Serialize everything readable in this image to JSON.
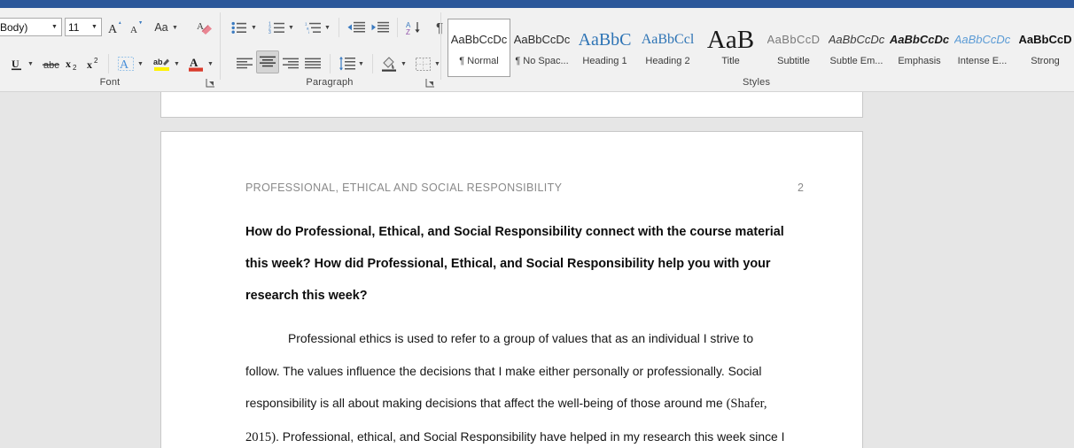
{
  "window": {
    "ribbon_tabstrip_color": "#2B579A",
    "ribbon_bg": "#F1F1F1",
    "canvas_bg": "#E6E6E6"
  },
  "ribbon": {
    "font_group": {
      "label": "Font",
      "font_name": {
        "value": "(Body)",
        "placeholder": "Font"
      },
      "font_size": {
        "value": "11",
        "placeholder": "Size"
      },
      "grow_font": "A",
      "shrink_font": "A",
      "change_case": "Aa",
      "clear_formatting": "Clear All Formatting",
      "underline": "U",
      "strikethrough": "abc",
      "subscript": "x",
      "subscript_sub": "2",
      "superscript": "x",
      "superscript_sup": "2",
      "text_effects": "A",
      "text_highlight": "ab",
      "font_color": "A",
      "dialog_launcher": "Font dialog launcher"
    },
    "paragraph_group": {
      "label": "Paragraph",
      "bullets": "Bullets",
      "numbering": "Numbering",
      "multilevel": "Multilevel List",
      "decrease_indent": "Decrease Indent",
      "increase_indent": "Increase Indent",
      "sort": "Sort",
      "show_marks": "¶",
      "align_left": "Align Left",
      "align_center": "Center",
      "align_right": "Align Right",
      "justify": "Justify",
      "line_spacing": "Line and Paragraph Spacing",
      "shading": "Shading",
      "borders": "Borders",
      "dialog_launcher": "Paragraph dialog launcher"
    },
    "styles_group": {
      "label": "Styles",
      "items": [
        {
          "preview": "AaBbCcDc",
          "name": "¶ Normal",
          "selected": true,
          "style": "normal"
        },
        {
          "preview": "AaBbCcDc",
          "name": "¶ No Spac...",
          "selected": false,
          "style": "normal"
        },
        {
          "preview": "AaBbC",
          "name": "Heading 1",
          "selected": false,
          "style": "h1"
        },
        {
          "preview": "AaBbCcl",
          "name": "Heading 2",
          "selected": false,
          "style": "h2"
        },
        {
          "preview": "AaB",
          "name": "Title",
          "selected": false,
          "style": "title"
        },
        {
          "preview": "AaBbCcD",
          "name": "Subtitle",
          "selected": false,
          "style": "subtitle"
        },
        {
          "preview": "AaBbCcDc",
          "name": "Subtle Em...",
          "selected": false,
          "style": "subtle-em"
        },
        {
          "preview": "AaBbCcDc",
          "name": "Emphasis",
          "selected": false,
          "style": "emphasis"
        },
        {
          "preview": "AaBbCcDc",
          "name": "Intense E...",
          "selected": false,
          "style": "intense-em"
        },
        {
          "preview": "AaBbCcD",
          "name": "Strong",
          "selected": false,
          "style": "strong"
        }
      ]
    }
  },
  "document": {
    "header": {
      "text": "PROFESSIONAL, ETHICAL AND SOCIAL RESPONSIBILITY",
      "page_number": "2"
    },
    "heading": "How do Professional, Ethical, and Social Responsibility connect with the course material this week? How did Professional, Ethical, and Social Responsibility help you with your research this week?",
    "body_part1": "Professional ethics is used to refer to a group of values that as an individual I strive to follow. The values influence the decisions that I make either personally or professionally.  Social responsibility is all about making decisions that affect the well-being of those around me ",
    "citation": "(Shafer, 2015)",
    "body_part2": ". Professional, ethical, and Social Responsibility have helped in my research this week since I"
  }
}
